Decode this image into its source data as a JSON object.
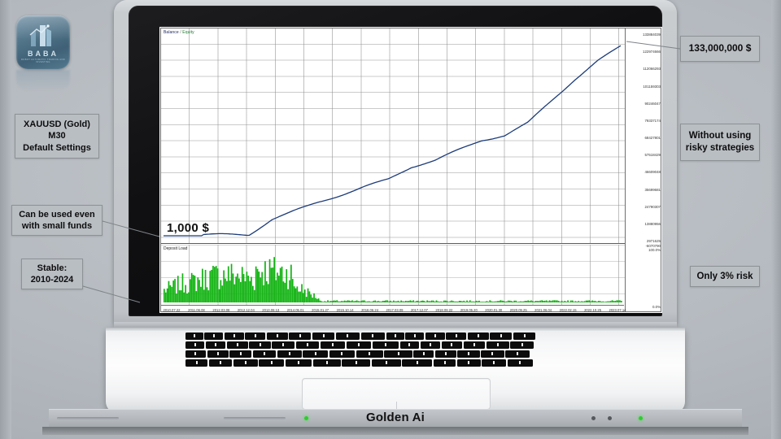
{
  "brand": {
    "logo_text": "BABA",
    "logo_sub": "ROBOT AUTOMATIC TRADING AND INVESTING",
    "footer_name": "Golden Ai"
  },
  "callouts": [
    {
      "id": "pair",
      "lines": [
        "XAUUSD (Gold)",
        "M30",
        "Default Settings"
      ]
    },
    {
      "id": "funds",
      "lines": [
        "Can be used even",
        "with small funds"
      ]
    },
    {
      "id": "stable",
      "lines": [
        "Stable:",
        "2010-2024"
      ]
    },
    {
      "id": "result",
      "lines": [
        "133,000,000 $"
      ]
    },
    {
      "id": "norisk",
      "lines": [
        "Without using",
        "risky strategies"
      ]
    },
    {
      "id": "risk",
      "lines": [
        "Only 3% risk"
      ]
    }
  ],
  "callout_text": {
    "pair_1": "XAUUSD (Gold)",
    "pair_2": "M30",
    "pair_3": "Default Settings",
    "funds_1": "Can be used even",
    "funds_2": "with small funds",
    "stable_1": "Stable:",
    "stable_2": "2010-2024",
    "result": "133,000,000 $",
    "norisk_1": "Without using",
    "norisk_2": "risky strategies",
    "risk": "Only 3% risk"
  },
  "chart_screen": {
    "legend_balance": "Balance",
    "legend_sep": "/",
    "legend_equity": "Equity",
    "deposit_legend": "Deposit Load",
    "start_balance_label": "1,000 $",
    "balance_color": "#1c3c7a",
    "equity_color": "#1f7a2e",
    "deposit_color": "#12b312"
  },
  "chart_data": {
    "type": "line",
    "title": "Balance / Equity",
    "xlabel": "",
    "ylabel": "Balance",
    "grid": true,
    "legend_position": "top-left",
    "series": [
      {
        "name": "Balance",
        "color": "#1c3c7a",
        "x": [
          "2010.07.22",
          "2011.06.08",
          "2012.03.08",
          "2012.12.04",
          "2013.08.13",
          "2014.05.01",
          "2015.01.27",
          "2015.10.14",
          "2016.06.24",
          "2017.03.09",
          "2017.12.07",
          "2018.08.22",
          "2019.05.20",
          "2020.01.30",
          "2020.09.25",
          "2021.06.04",
          "2022.02.15",
          "2022.10.25",
          "2023.07.14"
        ],
        "values": [
          1000,
          1100,
          3500,
          11529164,
          18000000,
          24344021,
          29621894,
          35000000,
          39715625,
          47903087,
          52000000,
          58996818,
          66096048,
          70000000,
          79184279,
          95000000,
          110000000,
          122966293,
          133000000
        ]
      },
      {
        "name": "Equity",
        "color": "#1f7a2e",
        "x": [
          "2010.07.22",
          "2023.07.14"
        ],
        "values": [
          1000,
          133000000
        ]
      }
    ],
    "y_ticks": [
      "133884039",
      "122974666",
      "112066293",
      "101159303",
      "90246047",
      "79337174",
      "68427801",
      "57518429",
      "46609048",
      "35699681",
      "24790307",
      "13880956",
      "2971625",
      "0"
    ],
    "y_ticks_display": [
      "133884039",
      "122974666",
      "112066293",
      "101159303",
      "90246047",
      "79337174",
      "68427801",
      "57518429",
      "46609048",
      "35699681",
      "24790307",
      "13880956",
      "2971625"
    ],
    "x_ticks": [
      "2010.07.22",
      "2011.06.08",
      "2012.03.08",
      "2012.12.04",
      "2013.08.13",
      "2014.05.01",
      "2015.01.27",
      "2015.10.14",
      "2016.06.24",
      "2017.03.09",
      "2017.12.07",
      "2018.08.22",
      "2019.05.20",
      "2020.01.30",
      "2020.09.25",
      "2021.06.04",
      "2022.02.15",
      "2022.10.25",
      "2023.07.14"
    ],
    "ylim": [
      0,
      140000000
    ],
    "subchart": {
      "type": "bar",
      "title": "Deposit Load",
      "color": "#12b312",
      "ylim": [
        0,
        100
      ],
      "y_ticks": [
        "-6070790 100.0%",
        "0.0%"
      ],
      "note": "Deposit load histogram, dense green spikes 2010-2013, near-zero afterwards"
    },
    "annotations": [
      {
        "text": "1,000 $",
        "position": "left-baseline"
      },
      {
        "text": "133,000,000 $",
        "position": "right-top"
      }
    ]
  }
}
